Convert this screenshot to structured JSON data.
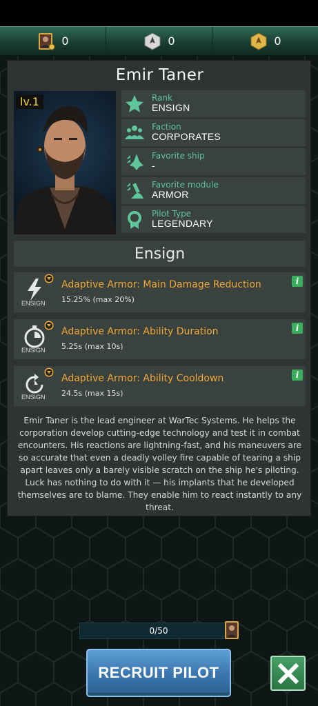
{
  "resources": [
    {
      "icon": "pilot-card-icon",
      "value": "0"
    },
    {
      "icon": "ship-token-icon",
      "value": "0"
    },
    {
      "icon": "gold-token-icon",
      "value": "0"
    }
  ],
  "pilot": {
    "name": "Emir Taner",
    "level": "lv.1",
    "info": [
      {
        "label": "Rank",
        "value": "ENSIGN",
        "icon": "star-icon"
      },
      {
        "label": "Faction",
        "value": "CORPORATES",
        "icon": "faction-people-icon"
      },
      {
        "label": "Favorite ship",
        "value": "-",
        "icon": "ship-icon"
      },
      {
        "label": "Favorite module",
        "value": "ARMOR",
        "icon": "module-icon"
      },
      {
        "label": "Pilot Type",
        "value": "LEGENDARY",
        "icon": "medal-icon"
      }
    ],
    "rank_header": "Ensign",
    "skills": [
      {
        "title": "Adaptive Armor: Main Damage Reduction",
        "value": "15.25% (max 20%)",
        "rank": "ENSIGN",
        "icon": "lightning-icon",
        "info": "i"
      },
      {
        "title": "Adaptive Armor: Ability Duration",
        "value": "5.25s (max 10s)",
        "rank": "ENSIGN",
        "icon": "stopwatch-icon",
        "info": "i"
      },
      {
        "title": "Adaptive Armor: Ability Cooldown",
        "value": "24.5s (max 15s)",
        "rank": "ENSIGN",
        "icon": "cooldown-icon",
        "info": "i"
      }
    ],
    "description": "Emir Taner is the lead engineer at WarTec Systems. He helps the corporation develop cutting-edge technology and test it in combat encounters. His reactions are lightning-fast, and his maneuvers are so accurate that even a deadly volley fire capable of tearing a ship apart leaves only a barely visible scratch on the ship he's piloting. Luck has nothing to do with it — his implants that he developed themselves are to blame. They enable him to react instantly to any threat."
  },
  "progress": {
    "text": "0/50",
    "fraction": 0
  },
  "recruit_label": "RECRUIT PILOT",
  "colors": {
    "accent_green": "#5fc59d",
    "skill_orange": "#f0a838",
    "level_yellow": "#f2d23a",
    "button_blue": "#3b78b0"
  }
}
